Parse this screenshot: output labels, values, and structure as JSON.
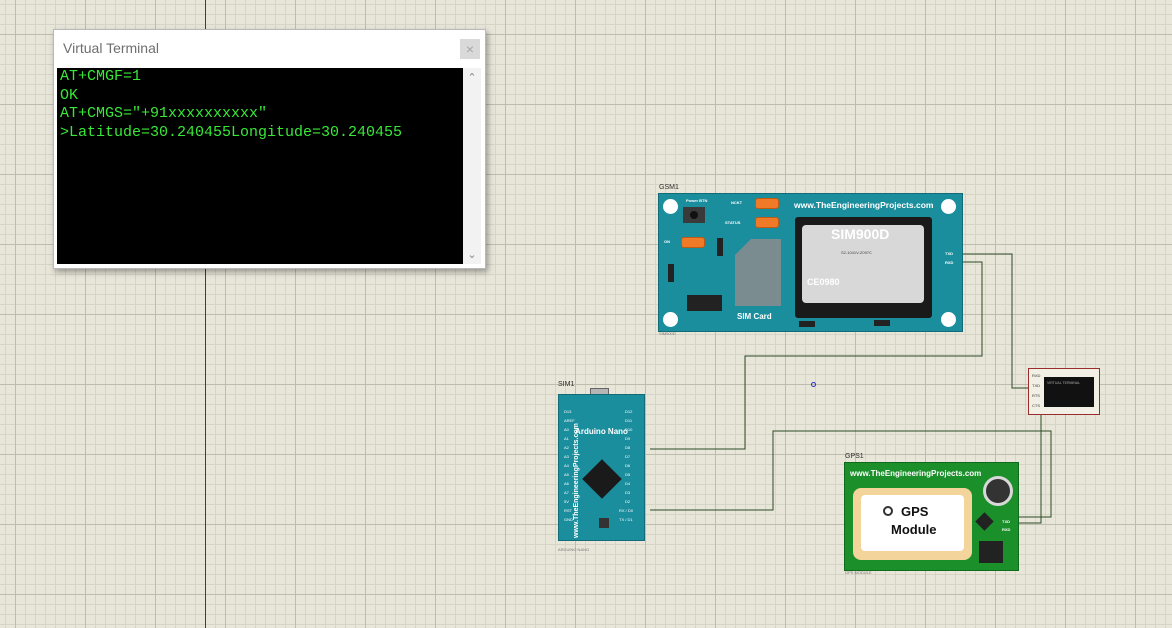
{
  "terminal": {
    "title": "Virtual Terminal",
    "close_glyph": "×",
    "lines": [
      "AT+CMGF=1",
      "OK",
      "AT+CMGS=\"+91xxxxxxxxxx\"",
      ">Latitude=30.240455Longitude=30.240455"
    ],
    "text_color": "#38e838"
  },
  "gsm": {
    "ref": "GSM1",
    "url": "www.TheEngineeringProjects.com",
    "chip_name": "SIM900D",
    "chip_code": "S2-1041V-Z097C",
    "chip_ce": "CE0980",
    "sim_label": "SIM Card",
    "power_label": "Power BTN",
    "netlight_label": "NCKT",
    "status_label": "STATUS",
    "on_label": "ON",
    "pin_tx": "TXD",
    "pin_rx": "RXD",
    "part": "SIM900D"
  },
  "arduino": {
    "ref": "SIM1",
    "title": "Arduino Nano",
    "url": "www.TheEngineeringProjects.com",
    "part": "ARDUINO NANO",
    "left_pins": [
      "D13",
      "AREF",
      "A0",
      "A1",
      "A2",
      "A3",
      "A4",
      "A5",
      "A6",
      "A7",
      "5V",
      "RST",
      "GND"
    ],
    "right_pins": [
      "D12",
      "D11",
      "D10",
      "D9",
      "D8",
      "D7",
      "D6",
      "D5",
      "D4",
      "D3",
      "D2",
      "RX / D0",
      "TX / D1"
    ]
  },
  "gps": {
    "ref": "GPS1",
    "url": "www.TheEngineeringProjects.com",
    "line1": "GPS",
    "line2": "Module",
    "pin_tx": "TXD",
    "pin_rx": "RXD",
    "part": "GPS MODULE"
  },
  "mini_terminal": {
    "text": "VIRTUAL TERMINAL",
    "pins": [
      "RXD",
      "TXD",
      "RTS",
      "CTS"
    ]
  },
  "colors": {
    "board_teal": "#1b8e9e",
    "gps_green": "#1a8f2a",
    "wire": "#1f3a1a",
    "grid_bg": "#e8e6d9"
  }
}
